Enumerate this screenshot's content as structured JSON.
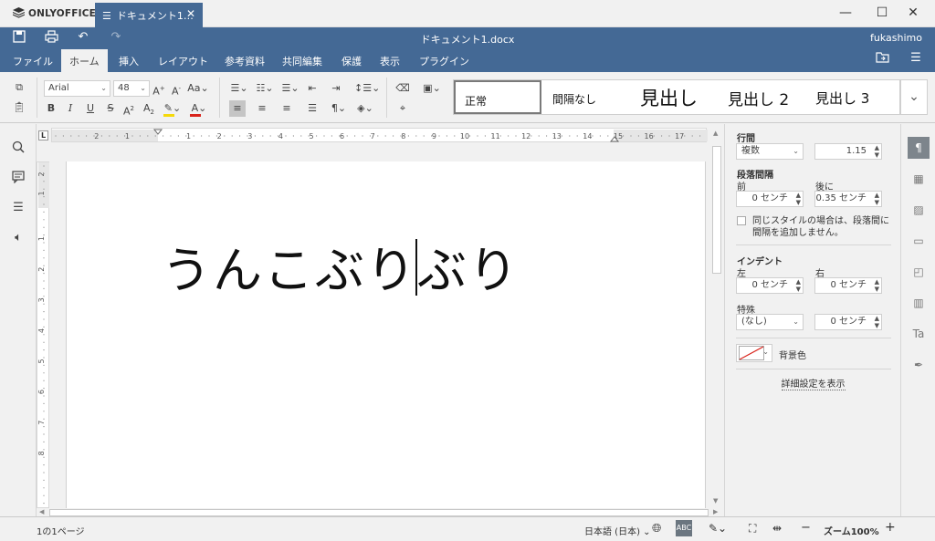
{
  "app": {
    "name": "ONLYOFFICE",
    "tab_title": "ドキュメント1…",
    "doc_title": "ドキュメント1.docx",
    "user": "fukashimo"
  },
  "menu": [
    "ファイル",
    "ホーム",
    "挿入",
    "レイアウト",
    "参考資料",
    "共同編集",
    "保護",
    "表示",
    "プラグイン"
  ],
  "menu_active": "ホーム",
  "toolbar": {
    "font_name": "Arial",
    "font_size": "48"
  },
  "styles": [
    "正常",
    "間隔なし",
    "見出し",
    "見出し 2",
    "見出し 3"
  ],
  "document": {
    "text": "うんこぶりぶり"
  },
  "ruler": {
    "top_numbers": [
      "2",
      "1",
      "1",
      "2",
      "3",
      "4",
      "5",
      "6",
      "7",
      "8",
      "9",
      "10",
      "11",
      "12",
      "13",
      "14",
      "15",
      "16",
      "17"
    ],
    "left_numbers": [
      "2",
      "1",
      "1",
      "2",
      "3",
      "4",
      "5",
      "6",
      "7",
      "8"
    ]
  },
  "panel": {
    "line_spacing_label": "行間",
    "line_spacing_type": "複数",
    "line_spacing_value": "1.15",
    "para_spacing_label": "段落間隔",
    "before_label": "前",
    "after_label": "後に",
    "before_value": "0 センチ",
    "after_value": "0.35 センチ",
    "same_style_text_1": "同じスタイルの場合は、段落間に",
    "same_style_text_2": "間隔を追加しません。",
    "indent_label": "インデント",
    "left_label": "左",
    "right_label": "右",
    "left_value": "0 センチ",
    "right_value": "0 センチ",
    "special_label": "特殊",
    "special_type": "(なし)",
    "special_value": "0 センチ",
    "background_label": "背景色",
    "advanced_link": "詳細設定を表示"
  },
  "status": {
    "page": "1の1ページ",
    "language": "日本語 (日本)",
    "zoom": "ズーム100%"
  },
  "colors": {
    "brand": "#446995",
    "toolbar_bg": "#f1f1f1",
    "highlight_bar": "#f5d90a",
    "font_color_bar": "#d9241c"
  }
}
